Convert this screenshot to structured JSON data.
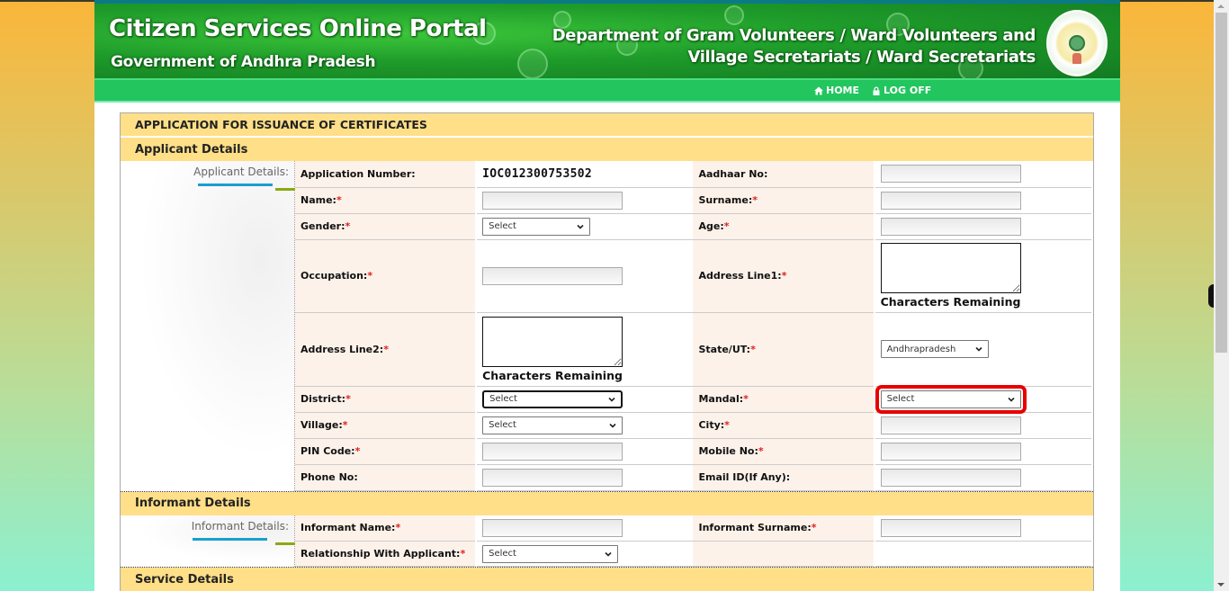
{
  "header": {
    "title": "Citizen Services Online Portal",
    "subtitle": "Government of Andhra Pradesh",
    "department_line1": "Department of Gram Volunteers / Ward Volunteers and",
    "department_line2": "Village Secretariats / Ward Secretariats",
    "emblem_icon": "ap-government-emblem"
  },
  "nav": {
    "home": {
      "label": "HOME",
      "icon": "home-icon"
    },
    "logoff": {
      "label": "LOG OFF",
      "icon": "lock-icon"
    }
  },
  "form": {
    "title": "APPLICATION FOR ISSUANCE OF CERTIFICATES",
    "applicant": {
      "section_title": "Applicant Details",
      "side_label": "Applicant Details:",
      "application_number_label": "Application Number:",
      "application_number": "IOC012300753502",
      "aadhaar_label": "Aadhaar No:",
      "aadhaar_value": "",
      "name_label": "Name:",
      "name_value": "",
      "surname_label": "Surname:",
      "surname_value": "",
      "gender_label": "Gender:",
      "gender_value": "Select",
      "age_label": "Age:",
      "age_value": "",
      "occupation_label": "Occupation:",
      "occupation_value": "",
      "address1_label": "Address Line1:",
      "address1_value": "",
      "address1_hint": "Characters Remaining",
      "address2_label": "Address Line2:",
      "address2_value": "",
      "address2_hint": "Characters Remaining",
      "state_label": "State/UT:",
      "state_value": "Andhrapradesh",
      "district_label": "District:",
      "district_value": "Select",
      "mandal_label": "Mandal:",
      "mandal_value": "Select",
      "village_label": "Village:",
      "village_value": "Select",
      "city_label": "City:",
      "city_value": "",
      "pin_label": "PIN Code:",
      "pin_value": "",
      "mobile_label": "Mobile No:",
      "mobile_value": "",
      "phone_label": "Phone No:",
      "phone_value": "",
      "email_label": "Email ID(If Any):",
      "email_value": ""
    },
    "informant": {
      "section_title": "Informant Details",
      "side_label": "Informant Details:",
      "name_label": "Informant Name:",
      "name_value": "",
      "surname_label": "Informant Surname:",
      "surname_value": "",
      "relationship_label": "Relationship With Applicant:",
      "relationship_value": "Select"
    },
    "service": {
      "section_title": "Service Details"
    },
    "required_marker": "*"
  },
  "colors": {
    "banner_green": "#1e9b2a",
    "nav_green": "#22c55e",
    "section_header": "#ffdf88",
    "label_bg": "#fdf2ea",
    "required": "#e02020",
    "highlight": "#e80000"
  }
}
